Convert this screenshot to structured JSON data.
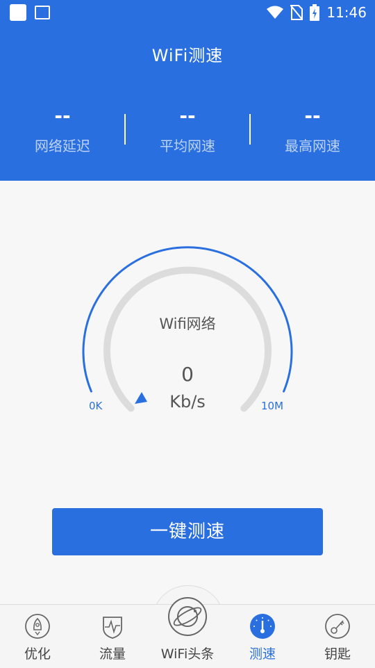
{
  "status_bar": {
    "time": "11:46"
  },
  "header": {
    "title": "WiFi测速",
    "stats": [
      {
        "value": "--",
        "label": "网络延迟"
      },
      {
        "value": "--",
        "label": "平均网速"
      },
      {
        "value": "--",
        "label": "最高网速"
      }
    ]
  },
  "gauge": {
    "network_label": "Wifi网络",
    "speed_value": "0",
    "speed_unit": "Kb/s",
    "min_label": "0K",
    "max_label": "10M",
    "level": 0
  },
  "action_button": {
    "label": "一键测速"
  },
  "tabs": [
    {
      "label": "优化",
      "icon": "rocket-icon"
    },
    {
      "label": "流量",
      "icon": "pulse-icon"
    },
    {
      "label": "WiFi头条",
      "icon": "planet-icon"
    },
    {
      "label": "测速",
      "icon": "speedometer-icon",
      "active": true
    },
    {
      "label": "钥匙",
      "icon": "key-icon"
    }
  ],
  "colors": {
    "primary": "#2a6fe0",
    "track": "#dcdcdc",
    "background": "#f7f7f7"
  }
}
